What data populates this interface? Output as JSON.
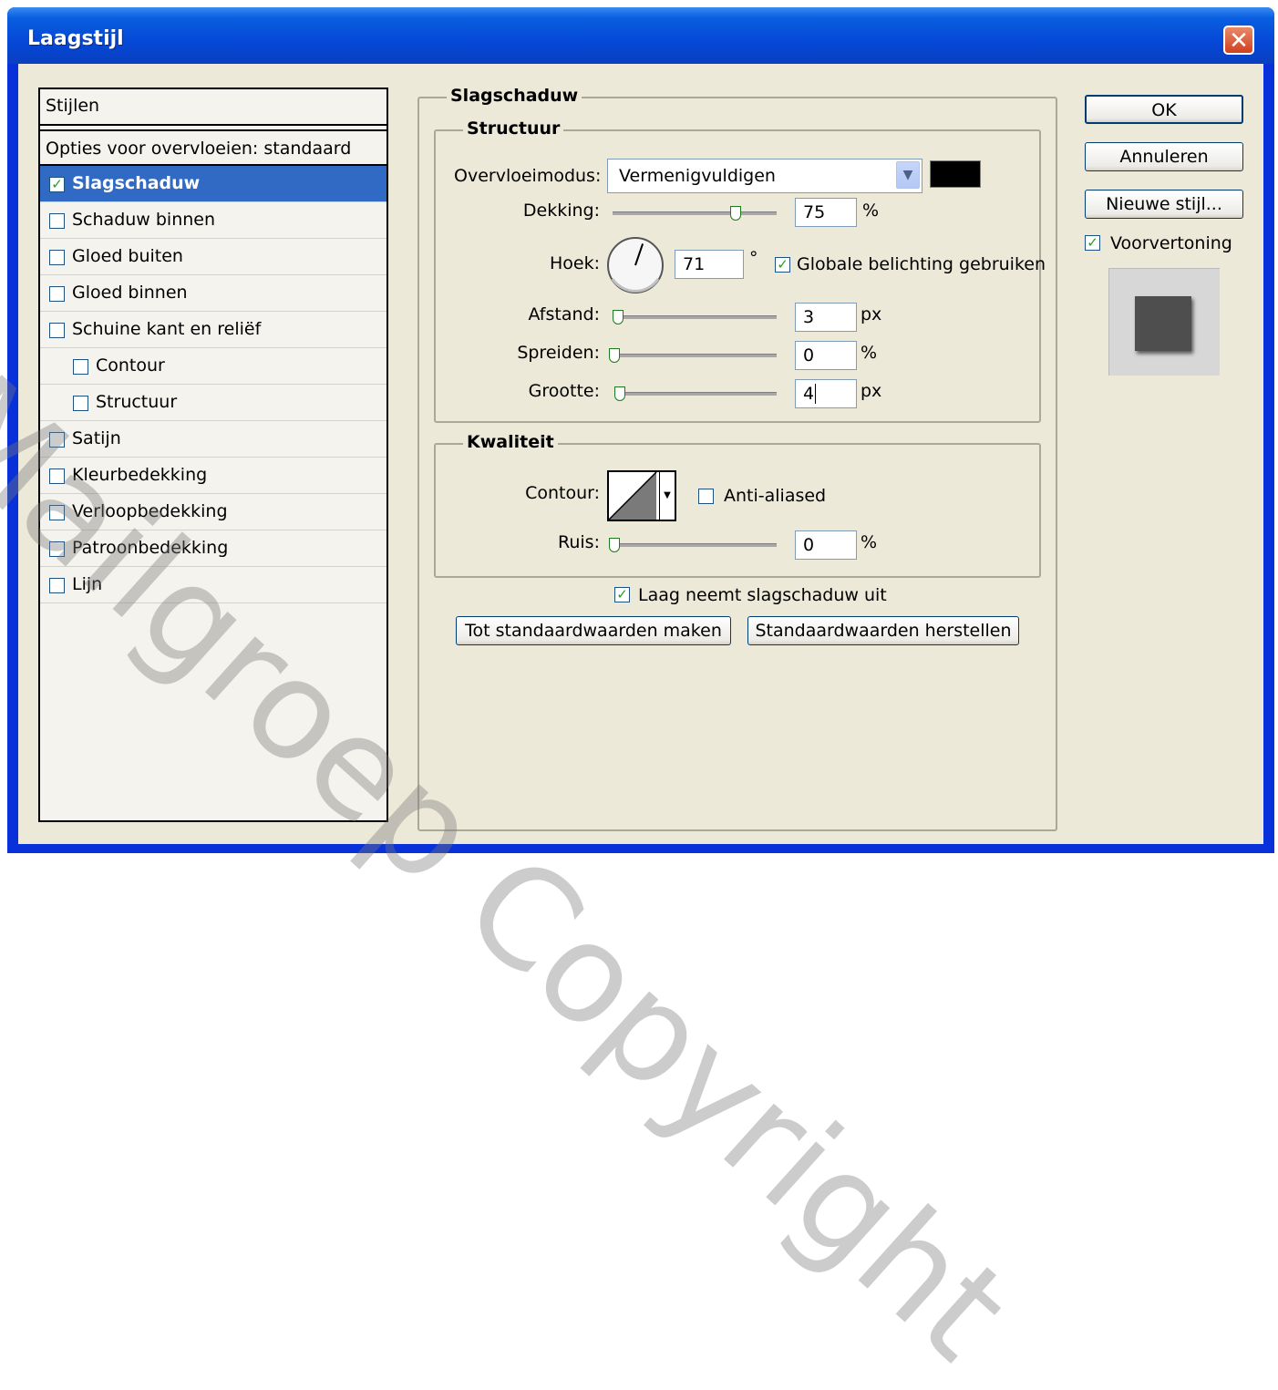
{
  "window": {
    "title": "Laagstijl",
    "close_symbol": "✕"
  },
  "styles": {
    "header": "Stijlen",
    "blending": "Opties voor overvloeien: standaard",
    "items": [
      {
        "label": "Slagschaduw",
        "checked": true,
        "selected": true
      },
      {
        "label": "Schaduw binnen",
        "checked": false
      },
      {
        "label": "Gloed buiten",
        "checked": false
      },
      {
        "label": "Gloed binnen",
        "checked": false
      },
      {
        "label": "Schuine kant en reliëf",
        "checked": false
      },
      {
        "label": "Contour",
        "checked": false
      },
      {
        "label": "Structuur",
        "checked": false
      },
      {
        "label": "Satijn",
        "checked": false
      },
      {
        "label": "Kleurbedekking",
        "checked": false
      },
      {
        "label": "Verloopbedekking",
        "checked": false
      },
      {
        "label": "Patroonbedekking",
        "checked": false
      },
      {
        "label": "Lijn",
        "checked": false
      }
    ]
  },
  "panel": {
    "title": "Slagschaduw",
    "structure": {
      "title": "Structuur",
      "blend_mode_label": "Overvloeimodus:",
      "blend_mode_value": "Vermenigvuldigen",
      "shadow_color": "#000000",
      "opacity_label": "Dekking:",
      "opacity_value": "75",
      "opacity_unit": "%",
      "opacity_fraction": 0.75,
      "angle_label": "Hoek:",
      "angle_value": "71",
      "angle_unit": "°",
      "global_light_label": "Globale belichting gebruiken",
      "global_light_checked": true,
      "distance_label": "Afstand:",
      "distance_value": "3",
      "distance_unit": "px",
      "spread_label": "Spreiden:",
      "spread_value": "0",
      "spread_unit": "%",
      "size_label": "Grootte:",
      "size_value": "4",
      "size_unit": "px"
    },
    "quality": {
      "title": "Kwaliteit",
      "contour_label": "Contour:",
      "anti_aliased_label": "Anti-aliased",
      "anti_aliased_checked": false,
      "noise_label": "Ruis:",
      "noise_value": "0",
      "noise_unit": "%"
    },
    "knockout_label": "Laag neemt slagschaduw uit",
    "knockout_checked": true,
    "make_default_label": "Tot standaardwaarden maken",
    "reset_default_label": "Standaardwaarden herstellen"
  },
  "buttons": {
    "ok": "OK",
    "cancel": "Annuleren",
    "new_style": "Nieuwe stijl..."
  },
  "preview": {
    "label": "Voorvertoning",
    "checked": true
  },
  "check_mark": "✓",
  "watermark": "Mailgroep Copyright"
}
